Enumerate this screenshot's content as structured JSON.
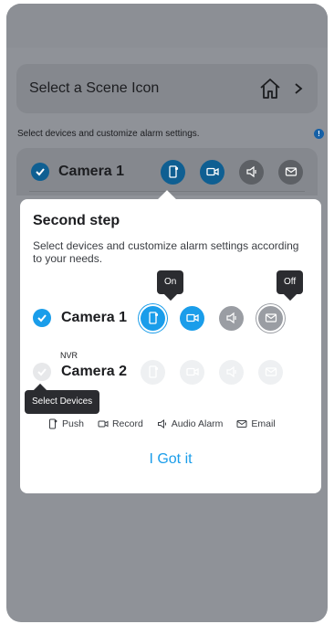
{
  "scene": {
    "label": "Select a Scene Icon"
  },
  "hint": {
    "text": "Select devices and customize alarm settings.",
    "info_icon": "!"
  },
  "background_device": {
    "name": "Camera 1"
  },
  "dialog": {
    "title": "Second step",
    "description": "Select devices and customize alarm settings according to your needs.",
    "devices": [
      {
        "name": "Camera 1",
        "checked": true,
        "icons": [
          "push-icon",
          "record-icon",
          "alarm-icon",
          "email-icon"
        ]
      },
      {
        "group": "NVR",
        "name": "Camera 2",
        "checked": false,
        "icons": [
          "push-icon",
          "record-icon",
          "alarm-icon",
          "email-icon"
        ]
      }
    ],
    "tooltips": {
      "on": "On",
      "off": "Off",
      "select_devices": "Select Devices"
    },
    "legend": {
      "push": "Push",
      "record": "Record",
      "audio_alarm": "Audio Alarm",
      "email": "Email"
    },
    "confirm_label": "I Got it"
  },
  "colors": {
    "accent": "#1a9dea",
    "grey_icon": "#9a9da3",
    "tooltip": "#2b2c30"
  }
}
